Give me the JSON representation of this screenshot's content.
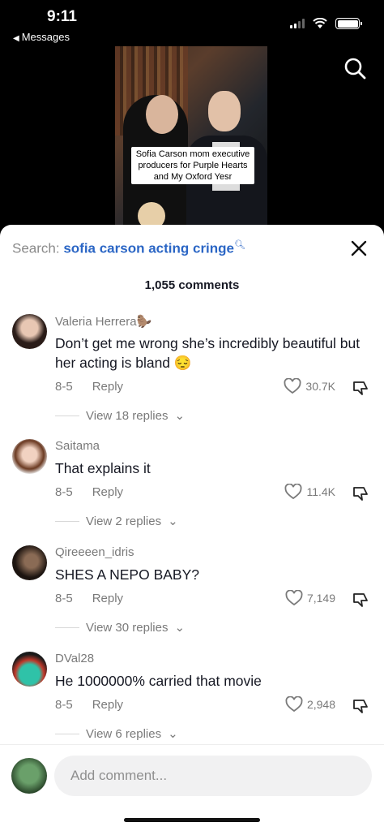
{
  "status_bar": {
    "time": "9:11",
    "back_app": "Messages"
  },
  "video": {
    "caption": "Sofia Carson mom executive producers for Purple Hearts and My Oxford Yesr"
  },
  "search": {
    "label": "Search:",
    "query": "sofia carson acting cringe"
  },
  "comments_count": "1,055 comments",
  "comments": [
    {
      "name": "Valeria Herrera",
      "name_suffix": "🦫",
      "text": "Don’t get me wrong she’s incredibly beautiful but her acting is bland 😔",
      "date": "8-5",
      "reply": "Reply",
      "likes": "30.7K",
      "view": "View 18 replies"
    },
    {
      "name": "Saitama",
      "name_suffix": "",
      "text": "That explains it",
      "date": "8-5",
      "reply": "Reply",
      "likes": "11.4K",
      "view": "View 2 replies"
    },
    {
      "name": "Qireeeen_idris",
      "name_suffix": "",
      "text": "SHES A NEPO BABY?",
      "date": "8-5",
      "reply": "Reply",
      "likes": "7,149",
      "view": "View 30 replies"
    },
    {
      "name": "DVal28",
      "name_suffix": "",
      "text": "He 1000000% carried that movie",
      "date": "8-5",
      "reply": "Reply",
      "likes": "2,948",
      "view": "View 6 replies"
    }
  ],
  "input": {
    "placeholder": "Add comment..."
  },
  "icons": [
    "search-icon",
    "close-icon",
    "heart-icon",
    "dislike-icon",
    "image-icon",
    "emoji-icon",
    "mention-icon",
    "gift-icon"
  ]
}
